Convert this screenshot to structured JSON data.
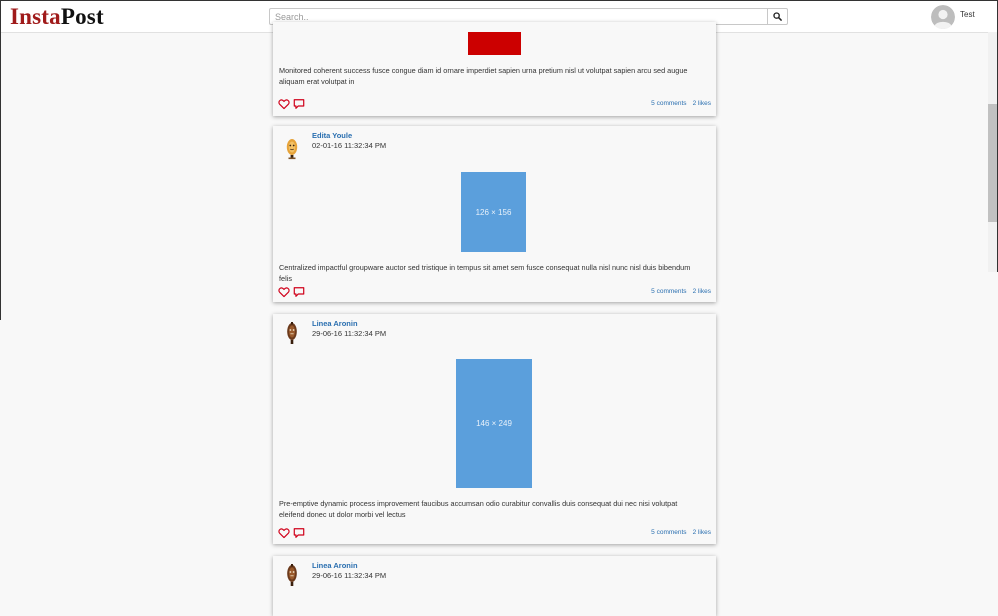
{
  "brand": {
    "part1": "Insta",
    "part2": "Post"
  },
  "search": {
    "placeholder": "Search.."
  },
  "user": {
    "name": "Test"
  },
  "colors": {
    "brand_red": "#a01b1b",
    "link_blue": "#2a6fb0",
    "placeholder_blue": "#5b9fdc",
    "heart_red": "#d0021b"
  },
  "posts": [
    {
      "caption": "Monitored coherent success fusce congue diam id ornare imperdiet sapien urna pretium nisl ut volutpat sapien arcu sed augue aliquam erat volutpat in",
      "comments": "5 comments",
      "likes": "2 likes"
    },
    {
      "author": "Edita Youle",
      "date": "02-01-16 11:32:34 PM",
      "image_label": "126 × 156",
      "caption": "Centralized impactful groupware auctor sed tristique in tempus sit amet sem fusce consequat nulla nisl nunc nisl duis bibendum felis",
      "comments": "5 comments",
      "likes": "2 likes"
    },
    {
      "author": "Linea Aronin",
      "date": "29-06-16 11:32:34 PM",
      "image_label": "146 × 249",
      "caption": "Pre-emptive dynamic process improvement faucibus accumsan odio curabitur convallis duis consequat dui nec nisi volutpat eleifend donec ut dolor morbi vel lectus",
      "comments": "5 comments",
      "likes": "2 likes"
    },
    {
      "author": "Linea Aronin",
      "date": "29-06-16 11:32:34 PM"
    }
  ],
  "icons": {
    "search": "search-icon",
    "avatar": "user-avatar-icon",
    "like": "heart-icon",
    "comment": "comment-icon"
  }
}
